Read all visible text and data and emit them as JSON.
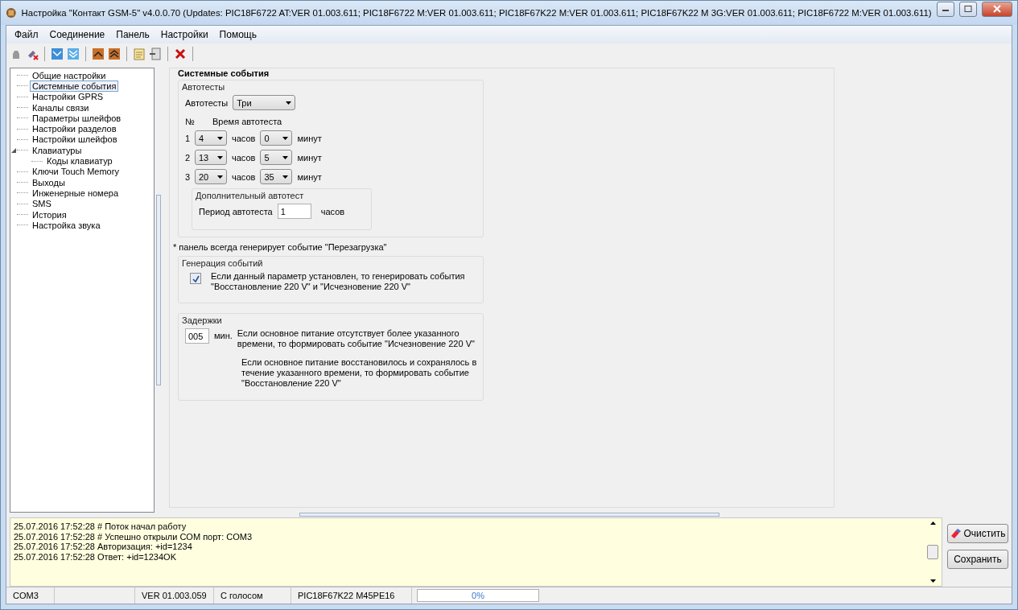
{
  "window": {
    "title": "Настройка \"Контакт GSM-5\" v4.0.0.70 (Updates: PIC18F6722 AT:VER 01.003.611; PIC18F6722 M:VER 01.003.611; PIC18F67K22 M:VER 01.003.611; PIC18F67K22 M 3G:VER 01.003.611; PIC18F6722 M:VER 01.003.611)"
  },
  "menu": [
    "Файл",
    "Соединение",
    "Панель",
    "Настройки",
    "Помощь"
  ],
  "tree": [
    {
      "label": "Общие настройки",
      "selected": false
    },
    {
      "label": "Системные события",
      "selected": true
    },
    {
      "label": "Настройки GPRS",
      "selected": false
    },
    {
      "label": "Каналы связи",
      "selected": false
    },
    {
      "label": "Параметры шлейфов",
      "selected": false
    },
    {
      "label": "Настройки разделов",
      "selected": false
    },
    {
      "label": "Настройки шлейфов",
      "selected": false
    },
    {
      "label": "Клавиатуры",
      "selected": false,
      "expanded": true,
      "children": [
        {
          "label": "Коды клавиатур",
          "selected": false
        }
      ]
    },
    {
      "label": "Ключи Touch Memory",
      "selected": false
    },
    {
      "label": "Выходы",
      "selected": false
    },
    {
      "label": "Инженерные номера",
      "selected": false
    },
    {
      "label": "SMS",
      "selected": false
    },
    {
      "label": "История",
      "selected": false
    },
    {
      "label": "Настройка звука",
      "selected": false
    }
  ],
  "page": {
    "title": "Системные события",
    "autotests": {
      "legend": "Автотесты",
      "count_label": "Автотесты",
      "count_value": "Три",
      "col_no": "№",
      "col_time": "Время автотеста",
      "rows": [
        {
          "no": "1",
          "hours": "4",
          "hours_unit": "часов",
          "minutes": "0",
          "minutes_unit": "минут"
        },
        {
          "no": "2",
          "hours": "13",
          "hours_unit": "часов",
          "minutes": "5",
          "minutes_unit": "минут"
        },
        {
          "no": "3",
          "hours": "20",
          "hours_unit": "часов",
          "minutes": "35",
          "minutes_unit": "минут"
        }
      ],
      "extra": {
        "legend": "Дополнительный автотест",
        "label": "Период автотеста",
        "value": "1",
        "unit": "часов"
      }
    },
    "note": "* панель всегда генерирует событие \"Перезагрузка\"",
    "generation": {
      "legend": "Генерация событий",
      "checked": true,
      "text": "Если данный параметр установлен, то генерировать события \"Восстановление 220 V\" и \"Исчезновение 220 V\""
    },
    "delays": {
      "legend": "Задержки",
      "value": "005",
      "unit": "мин.",
      "text_1": "Если основное питание отсутствует более указанного времени, то формировать событие \"Исчезновение 220 V\"",
      "text_2": "Если основное питание восстановилось и сохранялось в течение указанного времени, то формировать событие \"Восстановление 220 V\""
    }
  },
  "log": [
    "25.07.2016 17:52:28  # Поток начал работу",
    "25.07.2016 17:52:28  # Успешно открыли COM порт: COM3",
    "25.07.2016 17:52:28 Авторизация: +id=1234",
    "25.07.2016 17:52:28 Ответ: +id=1234OK"
  ],
  "log_buttons": [
    "Очистить",
    "Сохранить"
  ],
  "status_bar": {
    "port": "COM3",
    "version": "VER 01.003.059",
    "voice": "С голосом",
    "chip": "PIC18F67K22 M45PE16",
    "progress": {
      "level": 0,
      "reading": "0%"
    }
  }
}
